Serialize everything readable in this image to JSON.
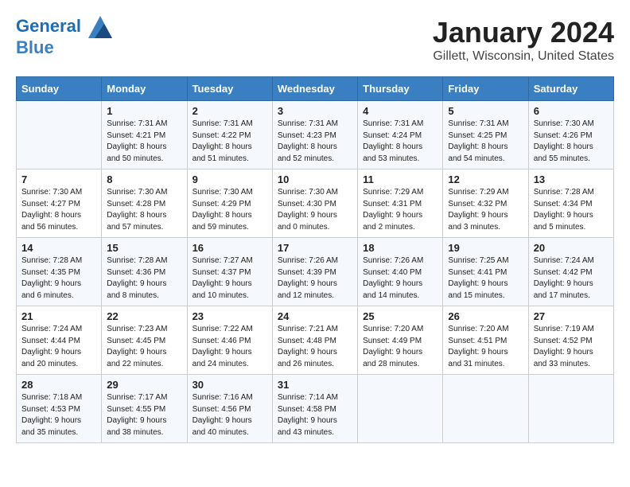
{
  "header": {
    "logo_line1": "General",
    "logo_line2": "Blue",
    "month_title": "January 2024",
    "location": "Gillett, Wisconsin, United States"
  },
  "weekdays": [
    "Sunday",
    "Monday",
    "Tuesday",
    "Wednesday",
    "Thursday",
    "Friday",
    "Saturday"
  ],
  "weeks": [
    [
      {
        "day": "",
        "sunrise": "",
        "sunset": "",
        "daylight": ""
      },
      {
        "day": "1",
        "sunrise": "Sunrise: 7:31 AM",
        "sunset": "Sunset: 4:21 PM",
        "daylight": "Daylight: 8 hours and 50 minutes."
      },
      {
        "day": "2",
        "sunrise": "Sunrise: 7:31 AM",
        "sunset": "Sunset: 4:22 PM",
        "daylight": "Daylight: 8 hours and 51 minutes."
      },
      {
        "day": "3",
        "sunrise": "Sunrise: 7:31 AM",
        "sunset": "Sunset: 4:23 PM",
        "daylight": "Daylight: 8 hours and 52 minutes."
      },
      {
        "day": "4",
        "sunrise": "Sunrise: 7:31 AM",
        "sunset": "Sunset: 4:24 PM",
        "daylight": "Daylight: 8 hours and 53 minutes."
      },
      {
        "day": "5",
        "sunrise": "Sunrise: 7:31 AM",
        "sunset": "Sunset: 4:25 PM",
        "daylight": "Daylight: 8 hours and 54 minutes."
      },
      {
        "day": "6",
        "sunrise": "Sunrise: 7:30 AM",
        "sunset": "Sunset: 4:26 PM",
        "daylight": "Daylight: 8 hours and 55 minutes."
      }
    ],
    [
      {
        "day": "7",
        "sunrise": "Sunrise: 7:30 AM",
        "sunset": "Sunset: 4:27 PM",
        "daylight": "Daylight: 8 hours and 56 minutes."
      },
      {
        "day": "8",
        "sunrise": "Sunrise: 7:30 AM",
        "sunset": "Sunset: 4:28 PM",
        "daylight": "Daylight: 8 hours and 57 minutes."
      },
      {
        "day": "9",
        "sunrise": "Sunrise: 7:30 AM",
        "sunset": "Sunset: 4:29 PM",
        "daylight": "Daylight: 8 hours and 59 minutes."
      },
      {
        "day": "10",
        "sunrise": "Sunrise: 7:30 AM",
        "sunset": "Sunset: 4:30 PM",
        "daylight": "Daylight: 9 hours and 0 minutes."
      },
      {
        "day": "11",
        "sunrise": "Sunrise: 7:29 AM",
        "sunset": "Sunset: 4:31 PM",
        "daylight": "Daylight: 9 hours and 2 minutes."
      },
      {
        "day": "12",
        "sunrise": "Sunrise: 7:29 AM",
        "sunset": "Sunset: 4:32 PM",
        "daylight": "Daylight: 9 hours and 3 minutes."
      },
      {
        "day": "13",
        "sunrise": "Sunrise: 7:28 AM",
        "sunset": "Sunset: 4:34 PM",
        "daylight": "Daylight: 9 hours and 5 minutes."
      }
    ],
    [
      {
        "day": "14",
        "sunrise": "Sunrise: 7:28 AM",
        "sunset": "Sunset: 4:35 PM",
        "daylight": "Daylight: 9 hours and 6 minutes."
      },
      {
        "day": "15",
        "sunrise": "Sunrise: 7:28 AM",
        "sunset": "Sunset: 4:36 PM",
        "daylight": "Daylight: 9 hours and 8 minutes."
      },
      {
        "day": "16",
        "sunrise": "Sunrise: 7:27 AM",
        "sunset": "Sunset: 4:37 PM",
        "daylight": "Daylight: 9 hours and 10 minutes."
      },
      {
        "day": "17",
        "sunrise": "Sunrise: 7:26 AM",
        "sunset": "Sunset: 4:39 PM",
        "daylight": "Daylight: 9 hours and 12 minutes."
      },
      {
        "day": "18",
        "sunrise": "Sunrise: 7:26 AM",
        "sunset": "Sunset: 4:40 PM",
        "daylight": "Daylight: 9 hours and 14 minutes."
      },
      {
        "day": "19",
        "sunrise": "Sunrise: 7:25 AM",
        "sunset": "Sunset: 4:41 PM",
        "daylight": "Daylight: 9 hours and 15 minutes."
      },
      {
        "day": "20",
        "sunrise": "Sunrise: 7:24 AM",
        "sunset": "Sunset: 4:42 PM",
        "daylight": "Daylight: 9 hours and 17 minutes."
      }
    ],
    [
      {
        "day": "21",
        "sunrise": "Sunrise: 7:24 AM",
        "sunset": "Sunset: 4:44 PM",
        "daylight": "Daylight: 9 hours and 20 minutes."
      },
      {
        "day": "22",
        "sunrise": "Sunrise: 7:23 AM",
        "sunset": "Sunset: 4:45 PM",
        "daylight": "Daylight: 9 hours and 22 minutes."
      },
      {
        "day": "23",
        "sunrise": "Sunrise: 7:22 AM",
        "sunset": "Sunset: 4:46 PM",
        "daylight": "Daylight: 9 hours and 24 minutes."
      },
      {
        "day": "24",
        "sunrise": "Sunrise: 7:21 AM",
        "sunset": "Sunset: 4:48 PM",
        "daylight": "Daylight: 9 hours and 26 minutes."
      },
      {
        "day": "25",
        "sunrise": "Sunrise: 7:20 AM",
        "sunset": "Sunset: 4:49 PM",
        "daylight": "Daylight: 9 hours and 28 minutes."
      },
      {
        "day": "26",
        "sunrise": "Sunrise: 7:20 AM",
        "sunset": "Sunset: 4:51 PM",
        "daylight": "Daylight: 9 hours and 31 minutes."
      },
      {
        "day": "27",
        "sunrise": "Sunrise: 7:19 AM",
        "sunset": "Sunset: 4:52 PM",
        "daylight": "Daylight: 9 hours and 33 minutes."
      }
    ],
    [
      {
        "day": "28",
        "sunrise": "Sunrise: 7:18 AM",
        "sunset": "Sunset: 4:53 PM",
        "daylight": "Daylight: 9 hours and 35 minutes."
      },
      {
        "day": "29",
        "sunrise": "Sunrise: 7:17 AM",
        "sunset": "Sunset: 4:55 PM",
        "daylight": "Daylight: 9 hours and 38 minutes."
      },
      {
        "day": "30",
        "sunrise": "Sunrise: 7:16 AM",
        "sunset": "Sunset: 4:56 PM",
        "daylight": "Daylight: 9 hours and 40 minutes."
      },
      {
        "day": "31",
        "sunrise": "Sunrise: 7:14 AM",
        "sunset": "Sunset: 4:58 PM",
        "daylight": "Daylight: 9 hours and 43 minutes."
      },
      {
        "day": "",
        "sunrise": "",
        "sunset": "",
        "daylight": ""
      },
      {
        "day": "",
        "sunrise": "",
        "sunset": "",
        "daylight": ""
      },
      {
        "day": "",
        "sunrise": "",
        "sunset": "",
        "daylight": ""
      }
    ]
  ]
}
